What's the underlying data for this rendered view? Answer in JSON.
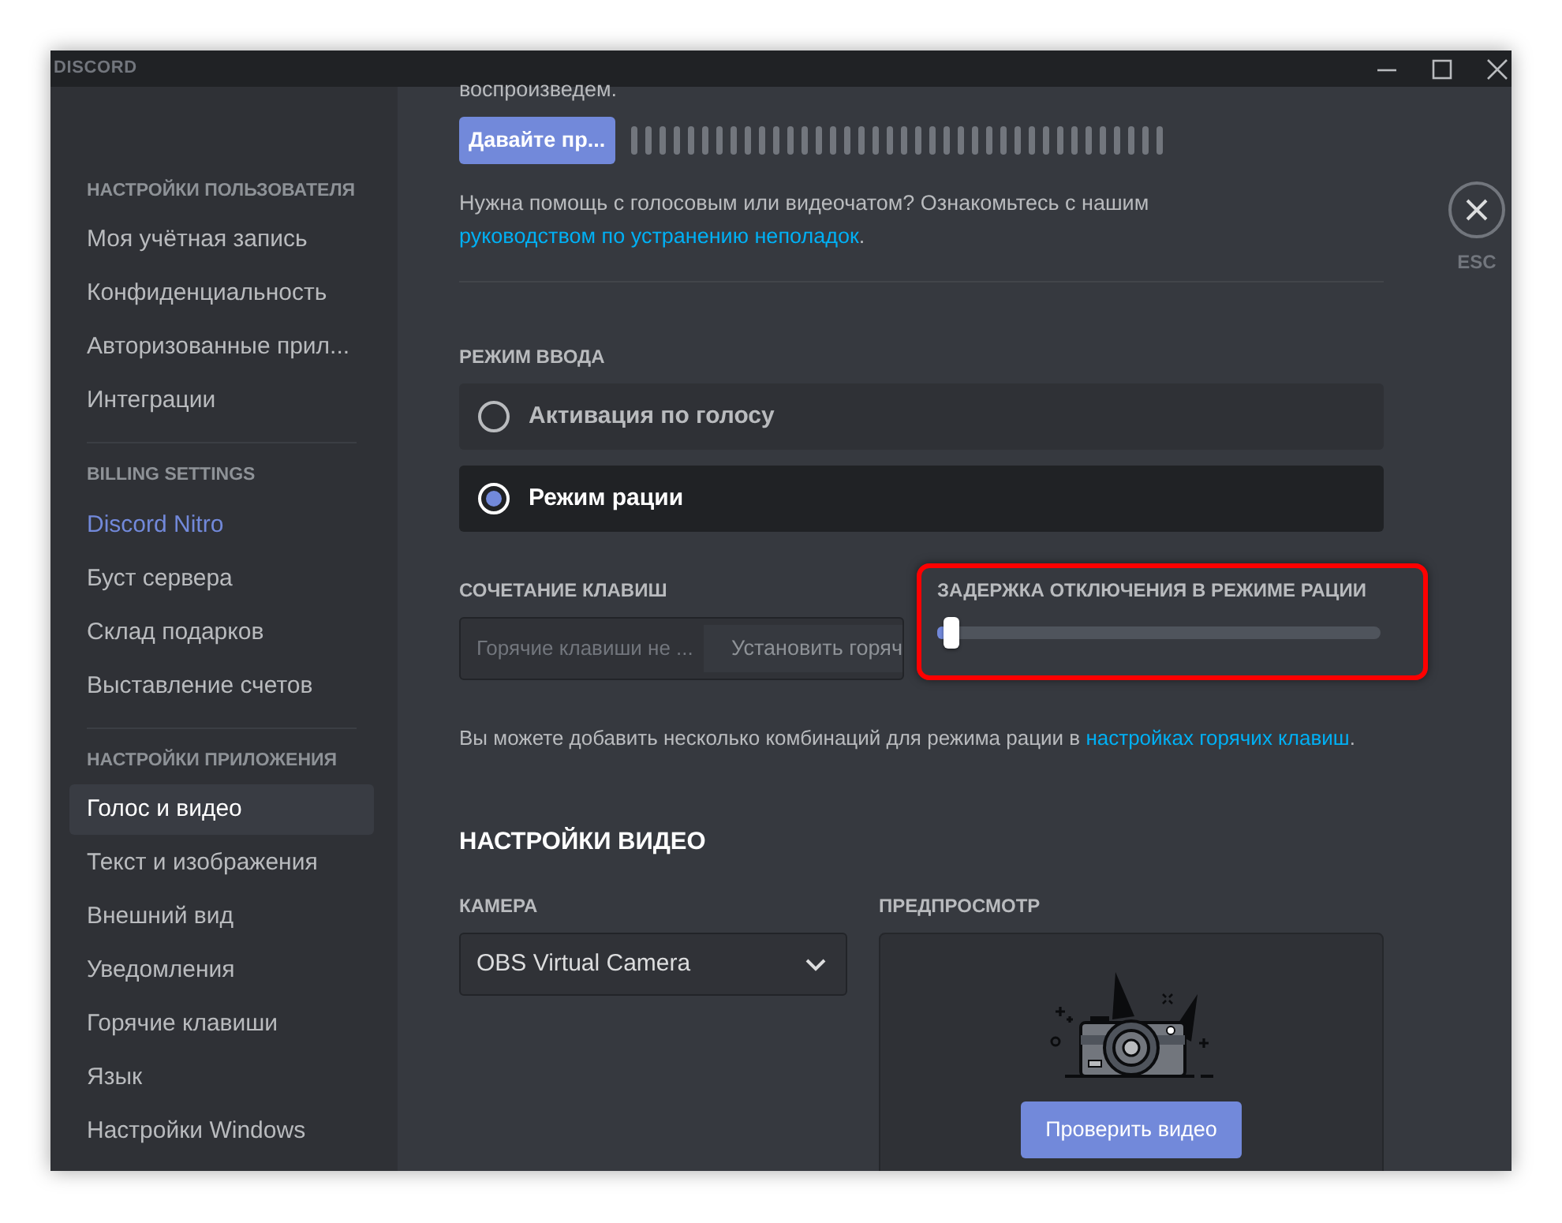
{
  "window": {
    "logo": "DISCORD"
  },
  "sidebar": {
    "sections": [
      {
        "header": "НАСТРОЙКИ ПОЛЬЗОВАТЕЛЯ",
        "items": [
          {
            "label": "Моя учётная запись",
            "selected": false,
            "kind": "plain"
          },
          {
            "label": "Конфиденциальность",
            "selected": false,
            "kind": "plain"
          },
          {
            "label": "Авторизованные прил...",
            "selected": false,
            "kind": "plain"
          },
          {
            "label": "Интеграции",
            "selected": false,
            "kind": "plain"
          }
        ]
      },
      {
        "header": "BILLING SETTINGS",
        "items": [
          {
            "label": "Discord Nitro",
            "selected": false,
            "kind": "accent"
          },
          {
            "label": "Буст сервера",
            "selected": false,
            "kind": "plain"
          },
          {
            "label": "Склад подарков",
            "selected": false,
            "kind": "plain"
          },
          {
            "label": "Выставление счетов",
            "selected": false,
            "kind": "plain"
          }
        ]
      },
      {
        "header": "НАСТРОЙКИ ПРИЛОЖЕНИЯ",
        "items": [
          {
            "label": "Голос и видео",
            "selected": true,
            "kind": "plain"
          },
          {
            "label": "Текст и изображения",
            "selected": false,
            "kind": "plain"
          },
          {
            "label": "Внешний вид",
            "selected": false,
            "kind": "plain"
          },
          {
            "label": "Уведомления",
            "selected": false,
            "kind": "plain"
          },
          {
            "label": "Горячие клавиши",
            "selected": false,
            "kind": "plain"
          },
          {
            "label": "Язык",
            "selected": false,
            "kind": "plain"
          },
          {
            "label": "Настройки Windows",
            "selected": false,
            "kind": "plain"
          }
        ]
      }
    ]
  },
  "voice": {
    "intro_tail": "воспроизведем.",
    "test_button": "Давайте пр...",
    "help": {
      "text": "Нужна помощь с голосовым или видеочатом? Ознакомьтесь с нашим",
      "link": "руководством по устранению неполадок",
      "after": "."
    },
    "input_mode": {
      "label": "РЕЖИМ ВВОДА",
      "options": [
        {
          "label": "Активация по голосу",
          "selected": false
        },
        {
          "label": "Режим рации",
          "selected": true
        }
      ]
    },
    "keybind": {
      "label": "СОЧЕТАНИЕ КЛАВИШ",
      "placeholder": "Горячие клавиши не ...",
      "button": "Установить горяч"
    },
    "release_delay": {
      "label": "ЗАДЕРЖКА ОТКЛЮЧЕНИЯ В РЕЖИМЕ РАЦИИ",
      "level": 0.02,
      "highlighted": true
    },
    "hint": {
      "text": "Вы можете добавить несколько комбинаций для режима рации в",
      "link": "настройках горячих клавиш",
      "after": "."
    }
  },
  "video": {
    "title": "НАСТРОЙКИ ВИДЕО",
    "camera": {
      "label": "КАМЕРА",
      "value": "OBS Virtual Camera"
    },
    "preview": {
      "label": "ПРЕДПРОСМОТР",
      "button": "Проверить видео"
    }
  },
  "close": {
    "label": "ESC"
  }
}
